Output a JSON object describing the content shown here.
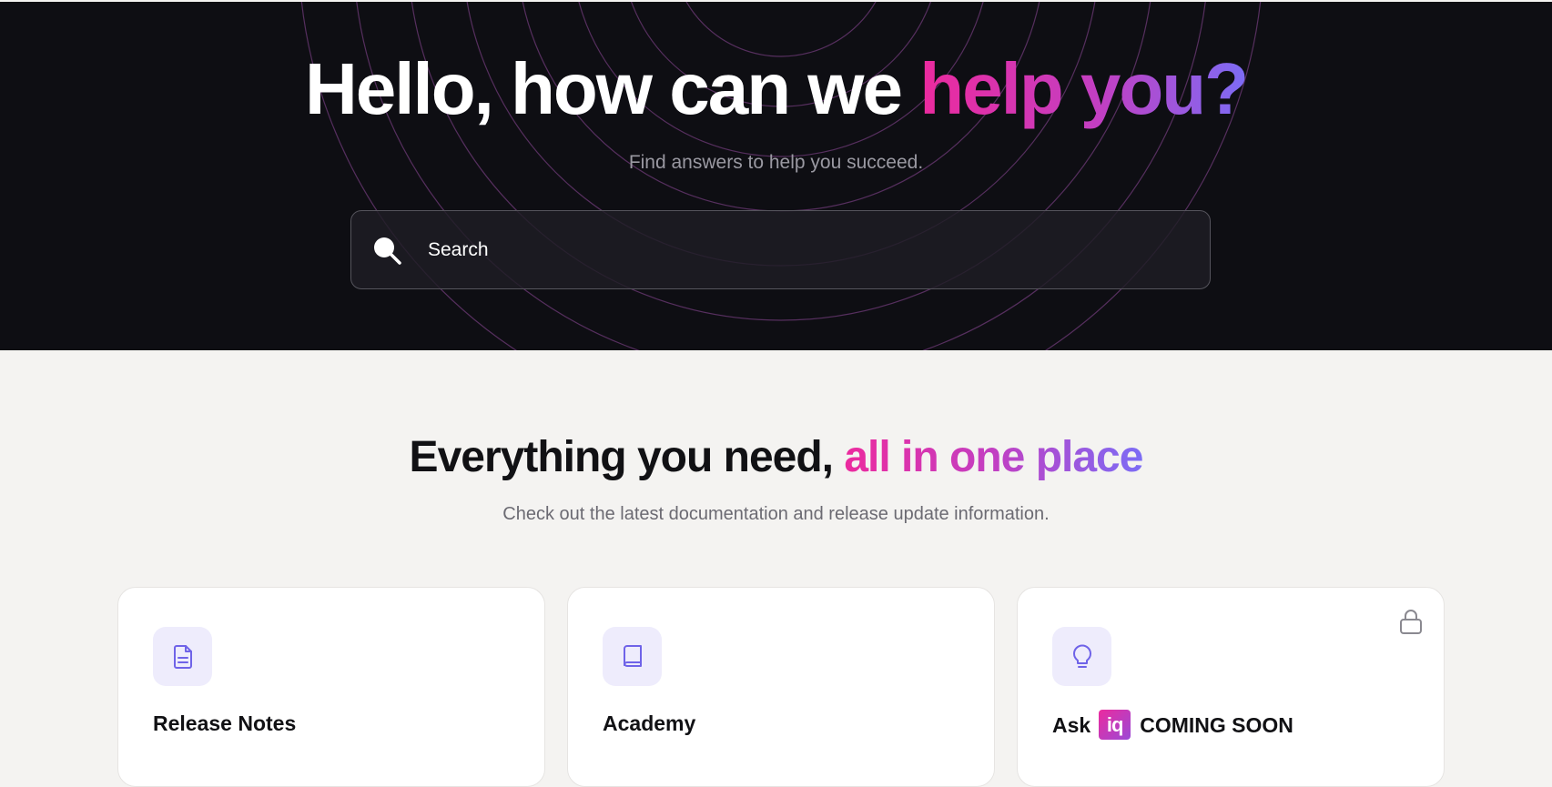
{
  "hero": {
    "title_plain": "Hello, how can we ",
    "title_highlight": "help you?",
    "subtitle": "Find answers to help you succeed."
  },
  "search": {
    "placeholder": "Search",
    "icon": "search-icon"
  },
  "section": {
    "title_plain": "Everything you need, ",
    "title_highlight": "all in one place",
    "subtitle": "Check out the latest documentation and release update information."
  },
  "cards": [
    {
      "title": "Release Notes",
      "icon": "document-icon"
    },
    {
      "title": "Academy",
      "icon": "book-icon"
    },
    {
      "title_prefix": "Ask",
      "badge": "iq",
      "title_suffix": "COMING SOON",
      "icon": "lightbulb-icon",
      "status_icon": "lock-icon"
    }
  ],
  "colors": {
    "hero_background": "#0e0e13",
    "page_background": "#f4f3f1",
    "gradient_pink": "#ec2a9e",
    "gradient_purple": "#c23fc2",
    "gradient_violet": "#7c6cf5",
    "icon_accent": "#6f63e8",
    "icon_tile": "#eeecfc"
  }
}
